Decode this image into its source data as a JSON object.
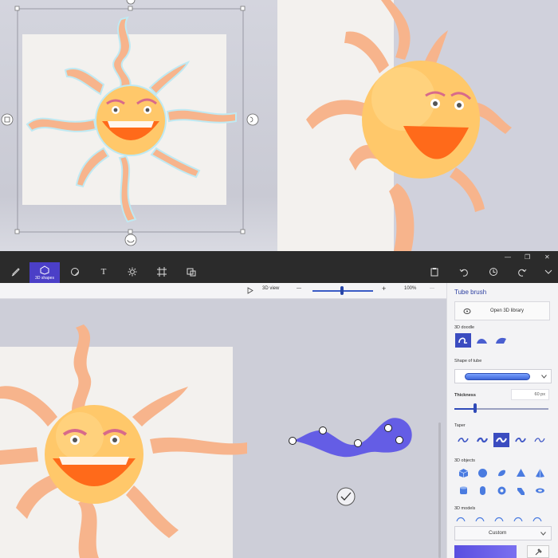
{
  "toolbar": {
    "tools": [
      {
        "icon": "brushes-icon"
      },
      {
        "icon": "3d-shapes-icon",
        "label": "3D shapes"
      },
      {
        "icon": "stickers-icon"
      },
      {
        "icon": "text-icon",
        "glyph": "T"
      },
      {
        "icon": "effects-icon"
      },
      {
        "icon": "canvas-icon"
      },
      {
        "icon": "3d-library-icon"
      }
    ],
    "right": [
      "paste-icon",
      "undo-icon",
      "history-icon",
      "redo-icon",
      "expand-icon"
    ]
  },
  "window": {
    "minimize": "—",
    "restore": "❐",
    "close": "✕"
  },
  "viewbar": {
    "view_label": "3D view",
    "zoom_minus": "—",
    "zoom_plus": "+",
    "zoom": "100%",
    "more": "···"
  },
  "panel": {
    "title": "Tube brush",
    "library_button": "Open 3D library",
    "doodle_label": "3D doodle",
    "shape_label": "Shape of tube",
    "thickness_label": "Thickness",
    "thickness_value": "60 px",
    "taper_label": "Taper",
    "objects_label": "3D objects",
    "models_label": "3D models",
    "color_mode": "Custom",
    "thickness_fraction": 0.22
  },
  "colors": {
    "accent": "#4b3fc7",
    "tube": "#5b54e6",
    "sun_face": "#ffc86a",
    "ray": "#f7b48c",
    "mouth": "#ff6a1a"
  }
}
